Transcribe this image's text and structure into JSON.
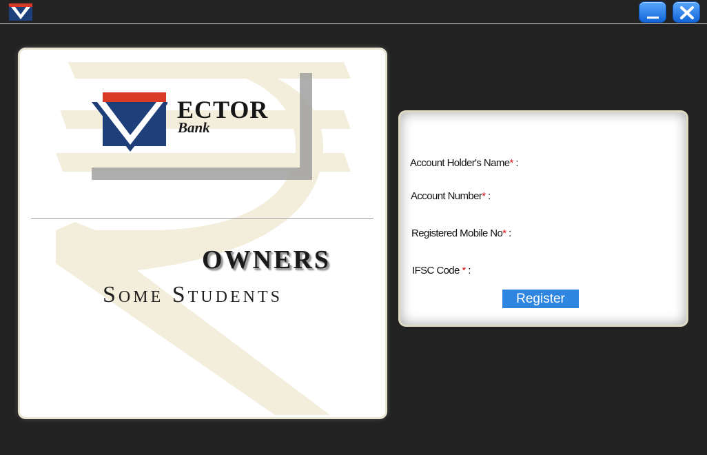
{
  "window": {
    "minimize_label": "_",
    "close_label": "✕"
  },
  "logo": {
    "word": "ECTOR",
    "sub": "Bank"
  },
  "owners_label": "OWNERS",
  "students_label": "Some Students",
  "form": {
    "fields": [
      {
        "label": "Account Holder's Name",
        "required": "*",
        "suffix": " :"
      },
      {
        "label": "Account Number",
        "required": "*",
        "suffix": " :"
      },
      {
        "label": "Registered Mobile No",
        "required": "*",
        "suffix": " :"
      },
      {
        "label": "IFSC Code ",
        "required": "*",
        "suffix": " :"
      }
    ],
    "register_label": "Register"
  },
  "colors": {
    "accent": "#2f86e0",
    "required": "#e01010",
    "logo_blue": "#1f3f7a",
    "logo_red": "#d93a26"
  },
  "icons": [
    "app-logo-icon",
    "minimize-icon",
    "close-icon",
    "rupee-watermark-icon"
  ]
}
